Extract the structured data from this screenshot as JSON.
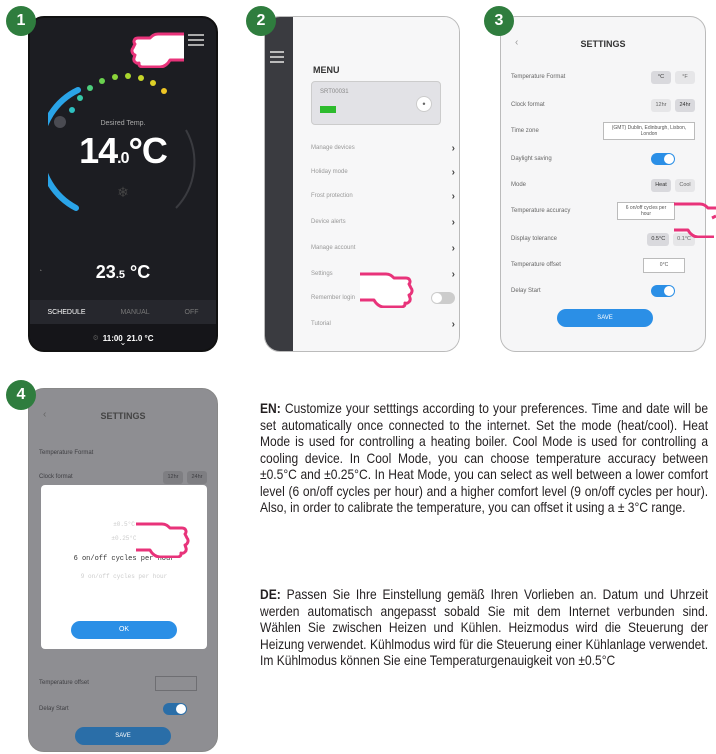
{
  "steps": [
    "1",
    "2",
    "3",
    "4"
  ],
  "screen1": {
    "desired_label": "Desired Temp.",
    "temp_main": "14",
    "temp_decimal": ".0",
    "temp_unit": "°C",
    "current_main": "23",
    "current_decimal": ".5",
    "current_unit": " °C",
    "tabs": [
      "SCHEDULE",
      "MANUAL",
      "OFF"
    ],
    "status_time": "11:00",
    "status_temp": "21.0 °C"
  },
  "screen2": {
    "menu_title": "MENU",
    "device_name": "SRT00031",
    "items": [
      "Manage devices",
      "Holiday mode",
      "Frost protection",
      "Device alerts",
      "Manage account",
      "Settings",
      "Remember login",
      "Tutorial"
    ]
  },
  "screen3": {
    "title": "SETTINGS",
    "rows": {
      "temp_format": "Temperature Format",
      "clock_format": "Clock format",
      "time_zone": "Time zone",
      "daylight": "Daylight saving",
      "mode": "Mode",
      "accuracy": "Temperature accuracy",
      "tolerance": "Display tolerance",
      "offset": "Temperature offset",
      "delay": "Delay Start"
    },
    "temp_format_opts": [
      "°C",
      "°F"
    ],
    "clock_opts": [
      "12hr",
      "24hr"
    ],
    "timezone_value": "(GMT) Dublin, Edinburgh, Lisbon, London",
    "mode_opts": [
      "Heat",
      "Cool"
    ],
    "accuracy_value": "6 on/off cycles per hour",
    "tolerance_opts": [
      "0.5°C",
      "0.1°C"
    ],
    "offset_value": "0°C",
    "save_label": "SAVE"
  },
  "screen4": {
    "title": "SETTINGS",
    "rows": {
      "temp_format": "Temperature Format",
      "clock_format": "Clock format",
      "offset": "Temperature offset",
      "delay": "Delay Start"
    },
    "clock_opts": [
      "12hr",
      "24hr"
    ],
    "dialog_options": [
      "±0.5°C",
      "±0.25°C",
      "6 on/off cycles per hour",
      "9 on/off cycles per hour"
    ],
    "ok_label": "OK",
    "save_label": "SAVE"
  },
  "text_en": {
    "tag": "EN:",
    "body": " Customize your setttings according to your preferences. Time and date will be set automatically once connected to the internet. Set the mode (heat/cool). Heat Mode is used for controlling a heating boiler. Cool Mode is used for controlling a cooling device. In Cool Mode, you can choose temperature accuracy between ±0.5°C and ±0.25°C. In Heat Mode, you can select as well between a lower comfort level (6 on/off cycles per hour) and a higher comfort level (9 on/off cycles per hour). Also, in order to calibrate the temperature, you can offset it using a ± 3°C range."
  },
  "text_de": {
    "tag": "DE:",
    "body": " Passen Sie Ihre Einstellung gemäß Ihren Vorlieben an. Datum und Uhrzeit werden automatisch angepasst sobald Sie mit dem Internet verbunden sind. Wählen Sie zwischen Heizen und Kühlen. Heizmodus wird die Steuerung der Heizung verwendet. Kühlmodus wird für die Steuerung einer Kühlanlage verwendet. Im Kühlmodus können Sie eine Temperaturgenauigkeit von ±0.5°C"
  },
  "colors": {
    "badge": "#2f7d3e",
    "accent_blue": "#2b8fe6",
    "hand": "#e8337a"
  }
}
